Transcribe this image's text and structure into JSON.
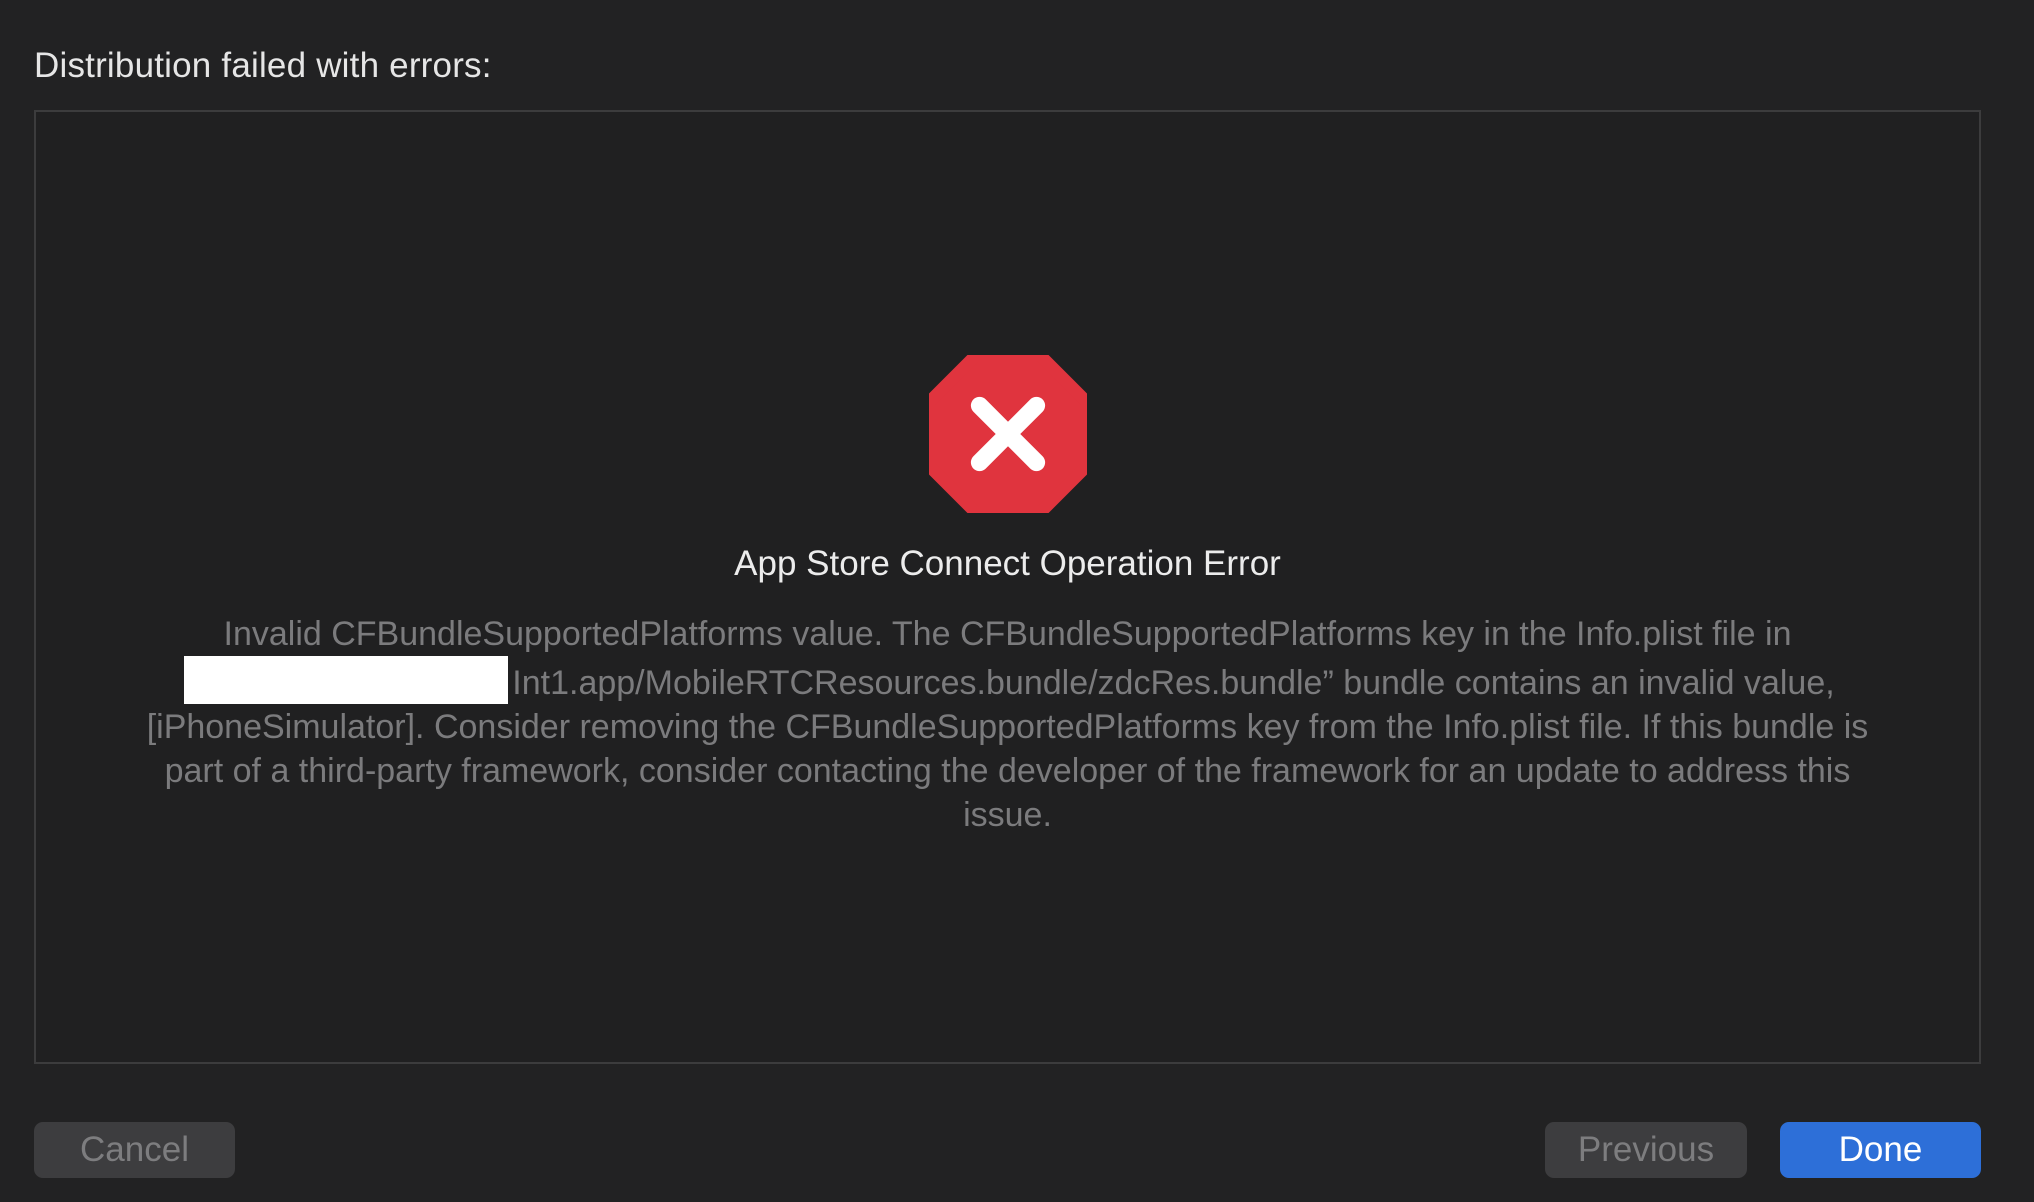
{
  "heading": "Distribution failed with errors:",
  "error": {
    "icon": "error-octagon-x-icon",
    "icon_color": "#e0343e",
    "title": "App Store Connect Operation Error",
    "message_before_redaction": "Invalid CFBundleSupportedPlatforms value. The CFBundleSupportedPlatforms key in the Info.plist file in",
    "message_after_redaction": "Int1.app/MobileRTCResources.bundle/zdcRes.bundle” bundle contains an invalid value, [iPhoneSimulator]. Consider removing the CFBundleSupportedPlatforms key from the Info.plist file. If this bundle is part of a third-party framework, consider contacting the developer of the framework for an update to address this issue."
  },
  "buttons": {
    "cancel": "Cancel",
    "previous": "Previous",
    "done": "Done"
  },
  "colors": {
    "background": "#222223",
    "accent": "#2d6fd8",
    "error": "#e0343e"
  }
}
